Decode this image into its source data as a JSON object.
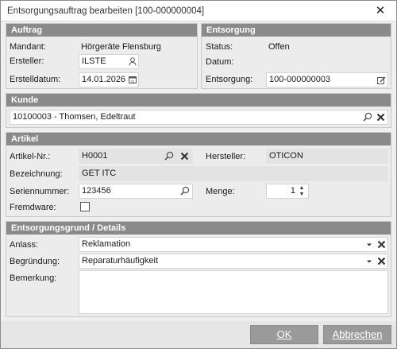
{
  "window": {
    "title": "Entsorgungsauftrag bearbeiten [100-000000004]",
    "close_glyph": "✕"
  },
  "auftrag": {
    "header": "Auftrag",
    "mandant_label": "Mandant:",
    "mandant_value": "Hörgeräte Flensburg",
    "ersteller_label": "Ersteller:",
    "ersteller_value": "ILSTE",
    "datum_label": "Erstelldatum:",
    "datum_value": "14.01.2026"
  },
  "entsorgung": {
    "header": "Entsorgung",
    "status_label": "Status:",
    "status_value": "Offen",
    "datum_label": "Datum:",
    "datum_value": "",
    "entsorgung_label": "Entsorgung:",
    "entsorgung_value": "100-000000003"
  },
  "kunde": {
    "header": "Kunde",
    "value": "10100003 - Thomsen, Edeltraut"
  },
  "artikel": {
    "header": "Artikel",
    "nr_label": "Artikel-Nr.:",
    "nr_value": "H0001",
    "hersteller_label": "Hersteller:",
    "hersteller_value": "OTICON",
    "bez_label": "Bezeichnung:",
    "bez_value": "GET ITC",
    "serien_label": "Seriennummer:",
    "serien_value": "123456",
    "menge_label": "Menge:",
    "menge_value": "1",
    "fremdware_label": "Fremdware:",
    "fremdware_checked": false
  },
  "details": {
    "header": "Entsorgungsgrund / Details",
    "anlass_label": "Anlass:",
    "anlass_value": "Reklamation",
    "begruendung_label": "Begründung:",
    "begruendung_value": "Reparaturhäufigkeit",
    "bemerkung_label": "Bemerkung:",
    "bemerkung_value": ""
  },
  "buttons": {
    "ok": "OK",
    "cancel": "Abbrechen"
  },
  "icons": [
    "user-icon",
    "calendar-icon",
    "edit-icon",
    "search-icon",
    "clear-icon",
    "dropdown-icon",
    "spin-up-icon",
    "spin-down-icon",
    "close-icon"
  ]
}
